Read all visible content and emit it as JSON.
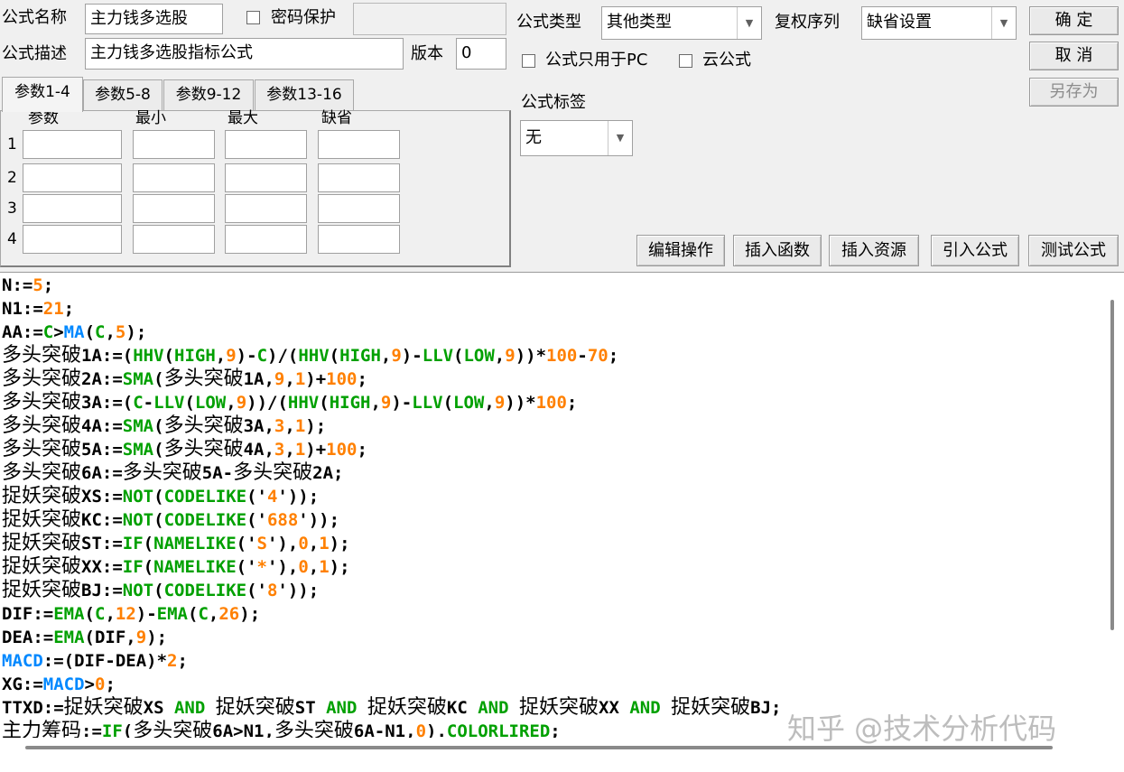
{
  "header": {
    "name_label": "公式名称",
    "name_value": "主力钱多选股",
    "password_label": "密码保护",
    "password_value": "",
    "desc_label": "公式描述",
    "desc_value": "主力钱多选股指标公式",
    "version_label": "版本",
    "version_value": "0",
    "type_label": "公式类型",
    "type_value": "其他类型",
    "rights_label": "复权序列",
    "rights_value": "缺省设置",
    "pc_only_label": "公式只用于PC",
    "cloud_label": "云公式",
    "tag_label": "公式标签",
    "tag_value": "无"
  },
  "buttons": {
    "ok": "确 定",
    "cancel": "取 消",
    "save_as": "另存为",
    "edit_ops": "编辑操作",
    "insert_func": "插入函数",
    "insert_res": "插入资源",
    "import_formula": "引入公式",
    "test_formula": "测试公式"
  },
  "params": {
    "tabs": [
      "参数1-4",
      "参数5-8",
      "参数9-12",
      "参数13-16"
    ],
    "columns": [
      "参数",
      "最小",
      "最大",
      "缺省"
    ],
    "rows": [
      "1",
      "2",
      "3",
      "4"
    ]
  },
  "code_lines": [
    [
      [
        "N:=",
        ""
      ],
      [
        "5",
        "o"
      ],
      [
        ";",
        ""
      ]
    ],
    [
      [
        "N1:=",
        ""
      ],
      [
        "21",
        "o"
      ],
      [
        ";",
        ""
      ]
    ],
    [
      [
        "AA:=",
        ""
      ],
      [
        "C",
        "g"
      ],
      [
        ">",
        ""
      ],
      [
        "MA",
        "b"
      ],
      [
        "(",
        ""
      ],
      [
        "C",
        "g"
      ],
      [
        ",",
        ""
      ],
      [
        "5",
        "o"
      ],
      [
        ");",
        ""
      ]
    ],
    [
      [
        "多头突破",
        "zh"
      ],
      [
        "1A:=(",
        ""
      ],
      [
        "HHV",
        "g"
      ],
      [
        "(",
        ""
      ],
      [
        "HIGH",
        "g"
      ],
      [
        ",",
        ""
      ],
      [
        "9",
        "o"
      ],
      [
        ")-",
        ""
      ],
      [
        "C",
        "g"
      ],
      [
        ")/(",
        ""
      ],
      [
        "HHV",
        "g"
      ],
      [
        "(",
        ""
      ],
      [
        "HIGH",
        "g"
      ],
      [
        ",",
        ""
      ],
      [
        "9",
        "o"
      ],
      [
        ")-",
        ""
      ],
      [
        "LLV",
        "g"
      ],
      [
        "(",
        ""
      ],
      [
        "LOW",
        "g"
      ],
      [
        ",",
        ""
      ],
      [
        "9",
        "o"
      ],
      [
        "))*",
        ""
      ],
      [
        "100",
        "o"
      ],
      [
        "-",
        ""
      ],
      [
        "70",
        "o"
      ],
      [
        ";",
        ""
      ]
    ],
    [
      [
        "多头突破",
        "zh"
      ],
      [
        "2A:=",
        ""
      ],
      [
        "SMA",
        "g"
      ],
      [
        "(",
        ""
      ],
      [
        "多头突破",
        "zh"
      ],
      [
        "1A,",
        ""
      ],
      [
        "9",
        "o"
      ],
      [
        ",",
        ""
      ],
      [
        "1",
        "o"
      ],
      [
        ")+",
        ""
      ],
      [
        "100",
        "o"
      ],
      [
        ";",
        ""
      ]
    ],
    [
      [
        "多头突破",
        "zh"
      ],
      [
        "3A:=(",
        ""
      ],
      [
        "C",
        "g"
      ],
      [
        "-",
        ""
      ],
      [
        "LLV",
        "g"
      ],
      [
        "(",
        ""
      ],
      [
        "LOW",
        "g"
      ],
      [
        ",",
        ""
      ],
      [
        "9",
        "o"
      ],
      [
        "))/(",
        ""
      ],
      [
        "HHV",
        "g"
      ],
      [
        "(",
        ""
      ],
      [
        "HIGH",
        "g"
      ],
      [
        ",",
        ""
      ],
      [
        "9",
        "o"
      ],
      [
        ")-",
        ""
      ],
      [
        "LLV",
        "g"
      ],
      [
        "(",
        ""
      ],
      [
        "LOW",
        "g"
      ],
      [
        ",",
        ""
      ],
      [
        "9",
        "o"
      ],
      [
        "))*",
        ""
      ],
      [
        "100",
        "o"
      ],
      [
        ";",
        ""
      ]
    ],
    [
      [
        "多头突破",
        "zh"
      ],
      [
        "4A:=",
        ""
      ],
      [
        "SMA",
        "g"
      ],
      [
        "(",
        ""
      ],
      [
        "多头突破",
        "zh"
      ],
      [
        "3A,",
        ""
      ],
      [
        "3",
        "o"
      ],
      [
        ",",
        ""
      ],
      [
        "1",
        "o"
      ],
      [
        ");",
        ""
      ]
    ],
    [
      [
        "多头突破",
        "zh"
      ],
      [
        "5A:=",
        ""
      ],
      [
        "SMA",
        "g"
      ],
      [
        "(",
        ""
      ],
      [
        "多头突破",
        "zh"
      ],
      [
        "4A,",
        ""
      ],
      [
        "3",
        "o"
      ],
      [
        ",",
        ""
      ],
      [
        "1",
        "o"
      ],
      [
        ")+",
        ""
      ],
      [
        "100",
        "o"
      ],
      [
        ";",
        ""
      ]
    ],
    [
      [
        "多头突破",
        "zh"
      ],
      [
        "6A:=",
        ""
      ],
      [
        "多头突破",
        "zh"
      ],
      [
        "5A-",
        ""
      ],
      [
        "多头突破",
        "zh"
      ],
      [
        "2A;",
        ""
      ]
    ],
    [
      [
        "捉妖突破",
        "zh"
      ],
      [
        "XS:=",
        ""
      ],
      [
        "NOT",
        "g"
      ],
      [
        "(",
        ""
      ],
      [
        "CODELIKE",
        "g"
      ],
      [
        "('",
        ""
      ],
      [
        "4",
        "o"
      ],
      [
        "'));",
        ""
      ]
    ],
    [
      [
        "捉妖突破",
        "zh"
      ],
      [
        "KC:=",
        ""
      ],
      [
        "NOT",
        "g"
      ],
      [
        "(",
        ""
      ],
      [
        "CODELIKE",
        "g"
      ],
      [
        "('",
        ""
      ],
      [
        "688",
        "o"
      ],
      [
        "'));",
        ""
      ]
    ],
    [
      [
        "捉妖突破",
        "zh"
      ],
      [
        "ST:=",
        ""
      ],
      [
        "IF",
        "g"
      ],
      [
        "(",
        ""
      ],
      [
        "NAMELIKE",
        "g"
      ],
      [
        "('",
        ""
      ],
      [
        "S",
        "o"
      ],
      [
        "'),",
        ""
      ],
      [
        "0",
        "o"
      ],
      [
        ",",
        ""
      ],
      [
        "1",
        "o"
      ],
      [
        ");",
        ""
      ]
    ],
    [
      [
        "捉妖突破",
        "zh"
      ],
      [
        "XX:=",
        ""
      ],
      [
        "IF",
        "g"
      ],
      [
        "(",
        ""
      ],
      [
        "NAMELIKE",
        "g"
      ],
      [
        "('",
        ""
      ],
      [
        "*",
        "o"
      ],
      [
        "'),",
        ""
      ],
      [
        "0",
        "o"
      ],
      [
        ",",
        ""
      ],
      [
        "1",
        "o"
      ],
      [
        ");",
        ""
      ]
    ],
    [
      [
        "捉妖突破",
        "zh"
      ],
      [
        "BJ:=",
        ""
      ],
      [
        "NOT",
        "g"
      ],
      [
        "(",
        ""
      ],
      [
        "CODELIKE",
        "g"
      ],
      [
        "('",
        ""
      ],
      [
        "8",
        "o"
      ],
      [
        "'));",
        ""
      ]
    ],
    [
      [
        "DIF:=",
        ""
      ],
      [
        "EMA",
        "g"
      ],
      [
        "(",
        ""
      ],
      [
        "C",
        "g"
      ],
      [
        ",",
        ""
      ],
      [
        "12",
        "o"
      ],
      [
        ")-",
        ""
      ],
      [
        "EMA",
        "g"
      ],
      [
        "(",
        ""
      ],
      [
        "C",
        "g"
      ],
      [
        ",",
        ""
      ],
      [
        "26",
        "o"
      ],
      [
        ");",
        ""
      ]
    ],
    [
      [
        "DEA:=",
        ""
      ],
      [
        "EMA",
        "g"
      ],
      [
        "(DIF,",
        ""
      ],
      [
        "9",
        "o"
      ],
      [
        ");",
        ""
      ]
    ],
    [
      [
        "MACD",
        "b"
      ],
      [
        ":=(DIF-DEA)*",
        ""
      ],
      [
        "2",
        "o"
      ],
      [
        ";",
        ""
      ]
    ],
    [
      [
        "XG:=",
        ""
      ],
      [
        "MACD",
        "b"
      ],
      [
        ">",
        ""
      ],
      [
        "0",
        "o"
      ],
      [
        ";",
        ""
      ]
    ],
    [
      [
        "TTXD:=",
        ""
      ],
      [
        "捉妖突破",
        "zh"
      ],
      [
        "XS ",
        ""
      ],
      [
        "AND",
        "g"
      ],
      [
        " ",
        ""
      ],
      [
        "捉妖突破",
        "zh"
      ],
      [
        "ST ",
        ""
      ],
      [
        "AND",
        "g"
      ],
      [
        " ",
        ""
      ],
      [
        "捉妖突破",
        "zh"
      ],
      [
        "KC ",
        ""
      ],
      [
        "AND",
        "g"
      ],
      [
        " ",
        ""
      ],
      [
        "捉妖突破",
        "zh"
      ],
      [
        "XX ",
        ""
      ],
      [
        "AND",
        "g"
      ],
      [
        " ",
        ""
      ],
      [
        "捉妖突破",
        "zh"
      ],
      [
        "BJ;",
        ""
      ]
    ],
    [
      [
        "主力筹码",
        "zh"
      ],
      [
        ":=",
        ""
      ],
      [
        "IF",
        "g"
      ],
      [
        "(",
        ""
      ],
      [
        "多头突破",
        "zh"
      ],
      [
        "6A>N1,",
        ""
      ],
      [
        "多头突破",
        "zh"
      ],
      [
        "6A-N1,",
        ""
      ],
      [
        "0",
        "o"
      ],
      [
        ").",
        ""
      ],
      [
        "COLORLIRED",
        "g"
      ],
      [
        ";",
        ""
      ]
    ]
  ],
  "watermark": "知乎 @技术分析代码"
}
